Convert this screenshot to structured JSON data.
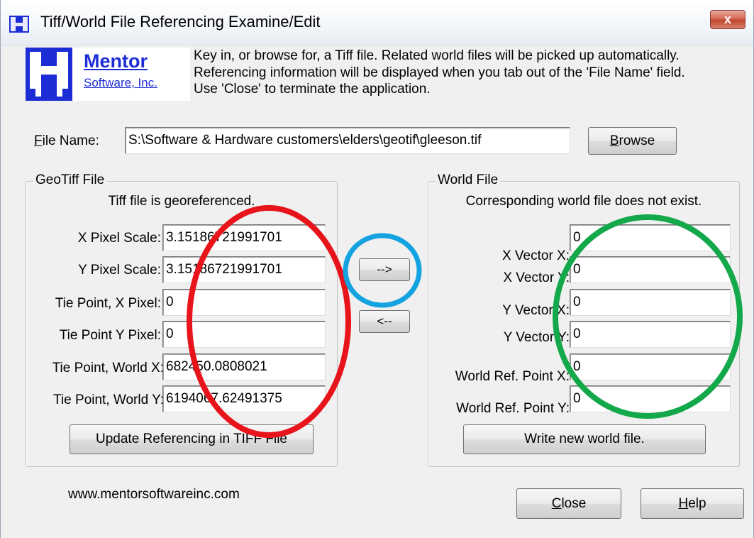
{
  "window": {
    "title": "Tiff/World File Referencing Examine/Edit",
    "close_symbol": "x"
  },
  "logo": {
    "name": "Mentor",
    "subtitle": "Software, Inc."
  },
  "instructions": [
    "Key in, or browse for, a Tiff file.  Related world files will be picked up automatically.",
    "Referencing information will be displayed when you tab out of the 'File Name' field.",
    "Use 'Close' to terminate the application."
  ],
  "file": {
    "label_mnemonic": "F",
    "label_rest": "ile Name:",
    "value": "S:\\Software & Hardware customers\\elders\\geotif\\gleeson.tif",
    "browse_mnemonic": "B",
    "browse_rest": "rowse"
  },
  "geotiff": {
    "title": "GeoTiff File",
    "status": "Tiff file is georeferenced.",
    "fields": [
      {
        "label": "X Pixel Scale:",
        "value": "3.15186721991701"
      },
      {
        "label": "Y Pixel Scale:",
        "value": "3.15186721991701"
      },
      {
        "label": "Tie Point, X Pixel:",
        "value": "0"
      },
      {
        "label": "Tie Point Y Pixel:",
        "value": "0"
      },
      {
        "label": "Tie Point, World X:",
        "value": "682450.0808021"
      },
      {
        "label": "Tie Point, World Y:",
        "value": "6194067.62491375"
      }
    ],
    "update_button": "Update Referencing in TIFF File"
  },
  "transfer": {
    "to_world": "-->",
    "to_tiff": "<--"
  },
  "world": {
    "title": "World File",
    "status": "Corresponding world file does not exist.",
    "fields": [
      {
        "label": "X Vector X:",
        "value": "0"
      },
      {
        "label": "X Vector Y:",
        "value": "0"
      },
      {
        "label": "Y Vector X:",
        "value": "0"
      },
      {
        "label": "Y Vector Y:",
        "value": "0"
      },
      {
        "label": "World Ref. Point X:",
        "value": "0"
      },
      {
        "label": "World Ref. Point Y:",
        "value": "0"
      }
    ],
    "write_button": "Write new world file."
  },
  "footer": {
    "website": "www.mentorsoftwareinc.com",
    "close_mnemonic": "C",
    "close_rest": "lose",
    "help_mnemonic": "H",
    "help_rest": "elp"
  },
  "annotations": {
    "red": "#e8141b",
    "blue": "#14a3e0",
    "green": "#13a84a"
  },
  "colors": {
    "brand_blue": "#1c2dd6"
  }
}
